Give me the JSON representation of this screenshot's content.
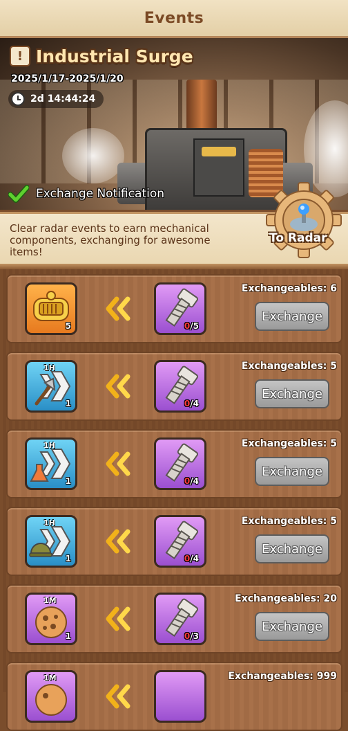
{
  "header": {
    "title": "Events"
  },
  "event": {
    "name": "Industrial Surge",
    "dates": "2025/1/17-2025/1/20",
    "countdown": "2d 14:44:24",
    "notification_label": "Exchange Notification",
    "description": "Clear radar events to earn mechanical components, exchanging for awesome items!",
    "radar_button": "To Radar"
  },
  "colors": {
    "accent": "#7b4a25",
    "count_have": "#ff3b3b",
    "button_disabled": "#a8a8a8"
  },
  "rows": [
    {
      "item_icon": "golden-mech-icon",
      "item_rarity": "orange",
      "item_duration": "",
      "item_qty": "5",
      "cost_have": "0",
      "cost_need": "/5",
      "exchangeables": "Exchangeables: 6",
      "button": "Exchange"
    },
    {
      "item_icon": "axe-speedup-icon",
      "item_rarity": "blue",
      "item_duration": "1H",
      "item_qty": "1",
      "cost_have": "0",
      "cost_need": "/4",
      "exchangeables": "Exchangeables: 5",
      "button": "Exchange"
    },
    {
      "item_icon": "flask-speedup-icon",
      "item_rarity": "blue",
      "item_duration": "1H",
      "item_qty": "1",
      "cost_have": "0",
      "cost_need": "/4",
      "exchangeables": "Exchangeables: 5",
      "button": "Exchange"
    },
    {
      "item_icon": "helmet-speedup-icon",
      "item_rarity": "blue",
      "item_duration": "1H",
      "item_qty": "1",
      "cost_have": "0",
      "cost_need": "/4",
      "exchangeables": "Exchangeables: 5",
      "button": "Exchange"
    },
    {
      "item_icon": "cookie-speedup-icon",
      "item_rarity": "purple",
      "item_duration": "1M",
      "item_qty": "1",
      "cost_have": "0",
      "cost_need": "/3",
      "exchangeables": "Exchangeables: 20",
      "button": "Exchange"
    },
    {
      "item_icon": "cookie-speedup-icon",
      "item_rarity": "purple",
      "item_duration": "1M",
      "item_qty": "",
      "cost_have": "",
      "cost_need": "",
      "exchangeables": "Exchangeables: 999",
      "button": ""
    }
  ]
}
